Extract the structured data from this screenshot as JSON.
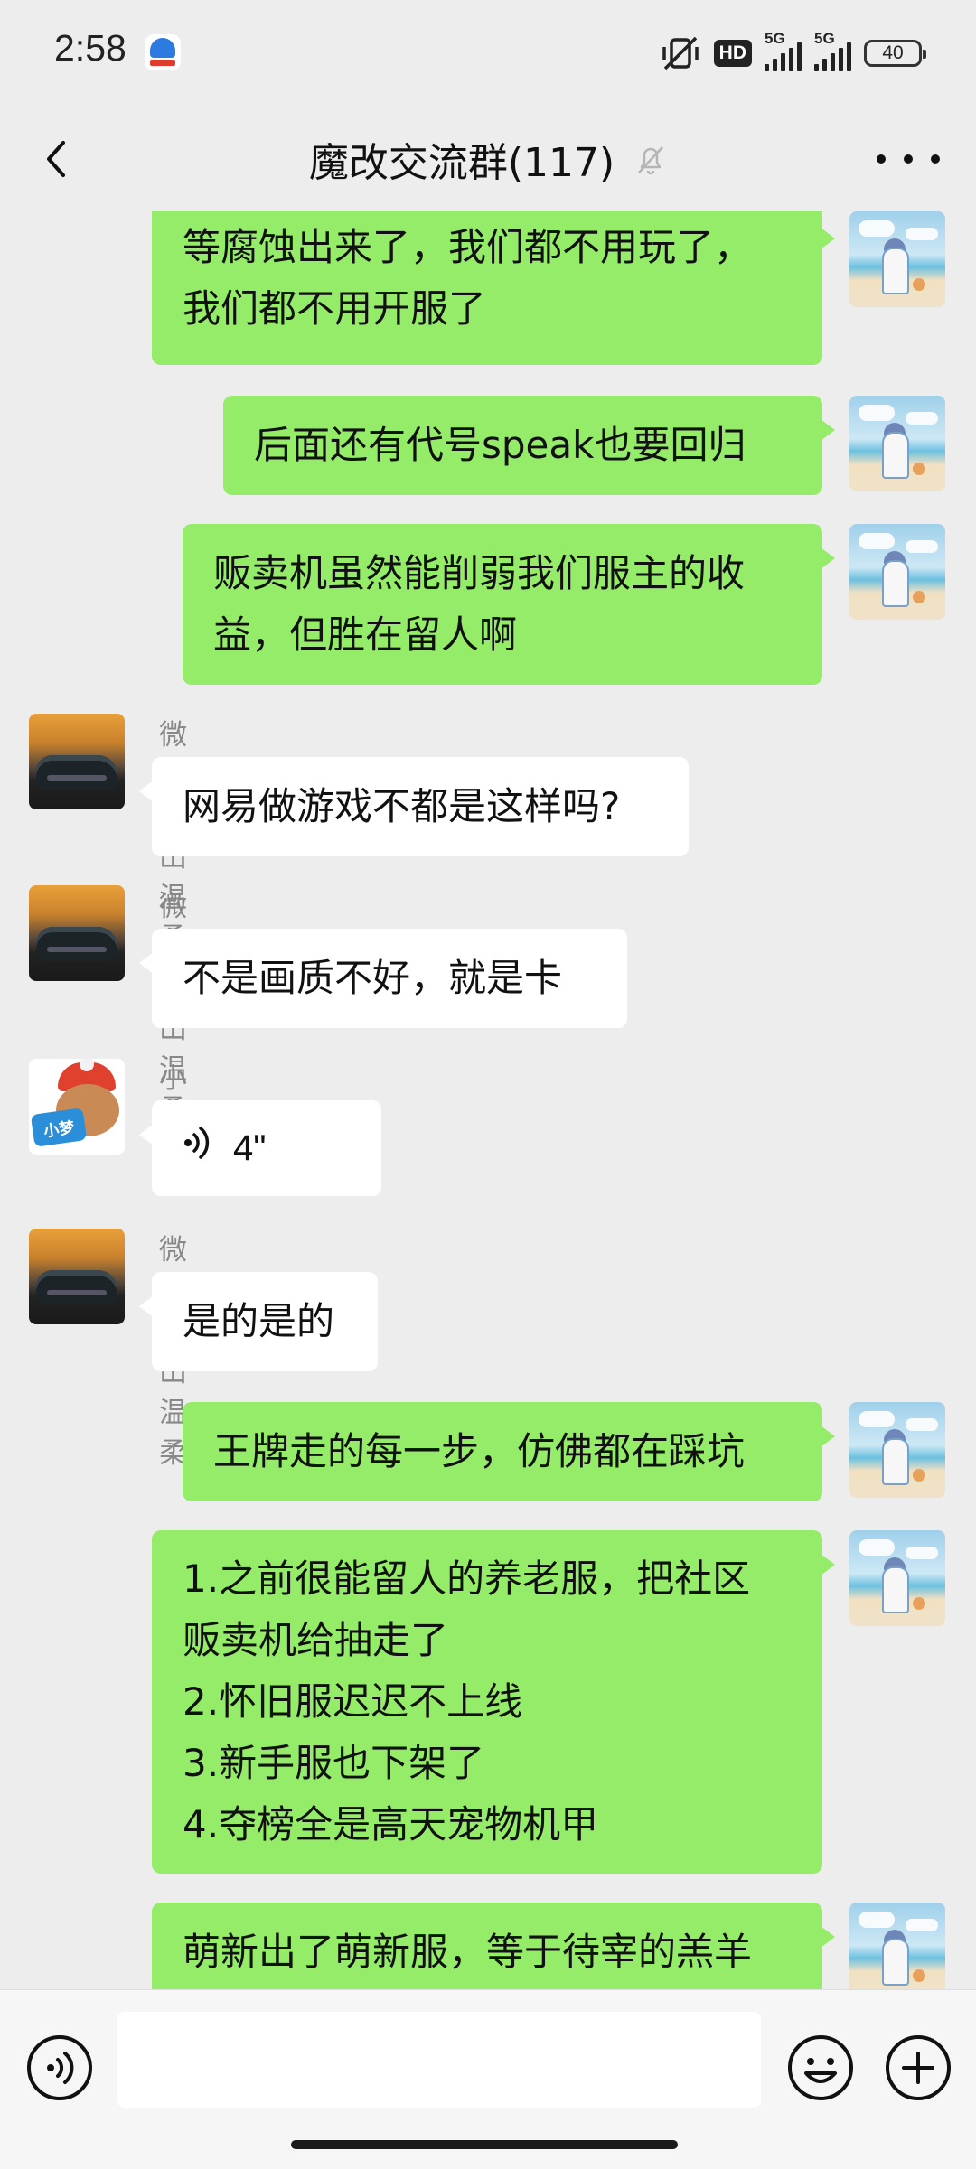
{
  "status_bar": {
    "time": "2:58",
    "hd_label": "HD",
    "signal_1_label": "5G",
    "signal_2_label": "5G",
    "battery": "40"
  },
  "header": {
    "title": "魔改交流群(117)",
    "back_icon": "chevron-left-icon",
    "muted_icon": "bell-off-icon",
    "more_icon": "more-dots-icon"
  },
  "messages": [
    {
      "from": "me",
      "lines": [
        "等腐蚀出来了，我们都不用玩了，",
        "我们都不用开服了"
      ]
    },
    {
      "from": "me",
      "lines": [
        "后面还有代号speak也要回归"
      ]
    },
    {
      "from": "me",
      "lines": [
        "贩卖机虽然能削弱我们服主的收",
        "益，但胜在留人啊"
      ]
    },
    {
      "from": "other",
      "sender": "微风吹出温柔",
      "lines": [
        "网易做游戏不都是这样吗?"
      ]
    },
    {
      "from": "other",
      "sender": "微风吹出温柔",
      "lines": [
        "不是画质不好，就是卡"
      ]
    },
    {
      "from": "other",
      "sender": "小丑",
      "voice_duration": "4\"",
      "voice_icon": "voice-wave-icon",
      "avatar_badge": "小梦"
    },
    {
      "from": "other",
      "sender": "微风吹出温柔",
      "lines": [
        "是的是的"
      ]
    },
    {
      "from": "me",
      "lines": [
        "王牌走的每一步，仿佛都在踩坑"
      ]
    },
    {
      "from": "me",
      "lines": [
        "1.之前很能留人的养老服，把社区",
        "贩卖机给抽走了",
        "2.怀旧服迟迟不上线",
        "3.新手服也下架了",
        "4.夺榜全是高天宠物机甲"
      ]
    },
    {
      "from": "me",
      "lines": [
        "萌新出了萌新服，等于待宰的羔羊"
      ]
    }
  ],
  "input_bar": {
    "voice_icon": "voice-input-icon",
    "text_value": "",
    "emoji_icon": "emoji-icon",
    "plus_icon": "plus-circle-icon"
  },
  "colors": {
    "my_bubble": "#95ec69",
    "other_bubble": "#ffffff",
    "background": "#ededed"
  }
}
